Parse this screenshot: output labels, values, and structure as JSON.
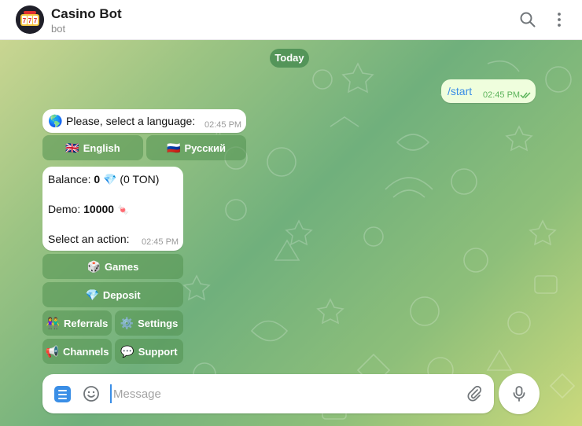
{
  "header": {
    "title": "Casino Bot",
    "subtitle": "bot",
    "avatar_icon": "slot-machine-777-icon",
    "search_icon": "search-icon",
    "menu_icon": "more-vertical-icon"
  },
  "chat": {
    "date_label": "Today",
    "outgoing": {
      "text": "/start",
      "time": "02:45 PM",
      "status_icon": "double-check-icon"
    },
    "language_prompt": {
      "emoji": "🌎",
      "text": "Please, select a language:",
      "time": "02:45 PM",
      "buttons": [
        {
          "flag": "🇬🇧",
          "label": "English"
        },
        {
          "flag": "🇷🇺",
          "label": "Русский"
        }
      ]
    },
    "menu_message": {
      "balance_prefix": "Balance: ",
      "balance_value": "0",
      "balance_emoji": "💎",
      "balance_ton": "(0 TON)",
      "demo_prefix": "Demo: ",
      "demo_value": "10000",
      "demo_emoji": "🍬",
      "action_text": "Select an action:",
      "time": "02:45 PM",
      "buttons": {
        "games": {
          "emoji": "🎲",
          "label": "Games"
        },
        "deposit": {
          "emoji": "💎",
          "label": "Deposit"
        },
        "referrals": {
          "emoji": "👫",
          "label": "Referrals"
        },
        "settings": {
          "emoji": "⚙️",
          "label": "Settings"
        },
        "channels": {
          "emoji": "📢",
          "label": "Channels"
        },
        "support": {
          "emoji": "💬",
          "label": "Support"
        }
      }
    }
  },
  "composer": {
    "placeholder": "Message",
    "value": "",
    "menu_icon": "bot-menu-icon",
    "emoji_icon": "emoji-icon",
    "attach_icon": "paperclip-icon",
    "mic_icon": "microphone-icon"
  },
  "colors": {
    "accent": "#3a8ee6",
    "outgoing_bubble": "#effedd",
    "read_check": "#5bb35a",
    "keyboard_button": "#529250"
  }
}
